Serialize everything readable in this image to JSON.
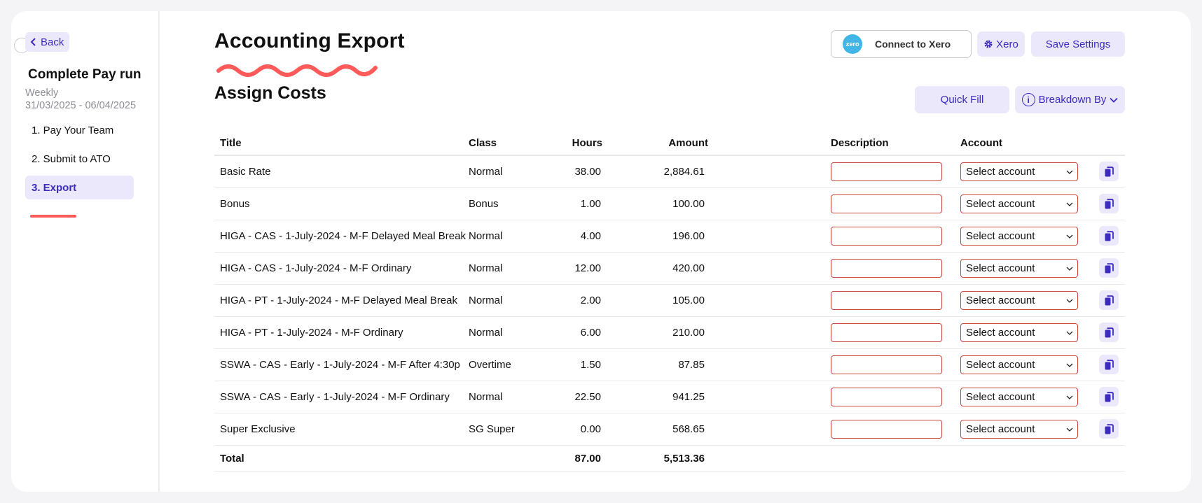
{
  "sidebar": {
    "back_label": "Back",
    "title": "Complete Pay run",
    "frequency": "Weekly",
    "period": "31/03/2025 - 06/04/2025",
    "steps": [
      {
        "label": "1. Pay Your Team"
      },
      {
        "label": "2. Submit to ATO"
      },
      {
        "label": "3. Export"
      }
    ],
    "active_step": 2
  },
  "header": {
    "title": "Accounting Export",
    "connect_label": "Connect to Xero",
    "xero_logo_text": "xero",
    "xero_settings_label": "Xero",
    "save_label": "Save Settings"
  },
  "section": {
    "title": "Assign Costs",
    "quick_fill_label": "Quick Fill",
    "breakdown_label": "Breakdown By"
  },
  "table": {
    "columns": {
      "title": "Title",
      "class": "Class",
      "hours": "Hours",
      "amount": "Amount",
      "description": "Description",
      "account": "Account"
    },
    "rows": [
      {
        "title": "Basic Rate",
        "class": "Normal",
        "hours": "38.00",
        "amount": "2,884.61",
        "description": "",
        "account": "Select account"
      },
      {
        "title": "Bonus",
        "class": "Bonus",
        "hours": "1.00",
        "amount": "100.00",
        "description": "",
        "account": "Select account"
      },
      {
        "title": "HIGA - CAS - 1-July-2024 - M-F Delayed Meal Break",
        "class": "Normal",
        "hours": "4.00",
        "amount": "196.00",
        "description": "",
        "account": "Select account"
      },
      {
        "title": "HIGA - CAS - 1-July-2024 - M-F Ordinary",
        "class": "Normal",
        "hours": "12.00",
        "amount": "420.00",
        "description": "",
        "account": "Select account"
      },
      {
        "title": "HIGA - PT - 1-July-2024 - M-F Delayed Meal Break",
        "class": "Normal",
        "hours": "2.00",
        "amount": "105.00",
        "description": "",
        "account": "Select account"
      },
      {
        "title": "HIGA - PT - 1-July-2024 - M-F Ordinary",
        "class": "Normal",
        "hours": "6.00",
        "amount": "210.00",
        "description": "",
        "account": "Select account"
      },
      {
        "title": "SSWA - CAS - Early - 1-July-2024 - M-F After 4:30p",
        "class": "Overtime",
        "hours": "1.50",
        "amount": "87.85",
        "description": "",
        "account": "Select account"
      },
      {
        "title": "SSWA - CAS - Early - 1-July-2024 - M-F Ordinary",
        "class": "Normal",
        "hours": "22.50",
        "amount": "941.25",
        "description": "",
        "account": "Select account"
      },
      {
        "title": "Super Exclusive",
        "class": "SG Super",
        "hours": "0.00",
        "amount": "568.65",
        "description": "",
        "account": "Select account"
      }
    ],
    "total": {
      "label": "Total",
      "hours": "87.00",
      "amount": "5,513.36"
    }
  },
  "colors": {
    "accent": "#3b2bbf",
    "accent_bg": "#ebe8fb",
    "error_border": "#c9483f",
    "annotation_red": "#ff5a5a",
    "xero_blue": "#41b5e5"
  },
  "icons": [
    "chevron-left-icon",
    "gear-icon",
    "info-icon",
    "chevron-down-icon",
    "copy-icon",
    "xero-logo"
  ]
}
